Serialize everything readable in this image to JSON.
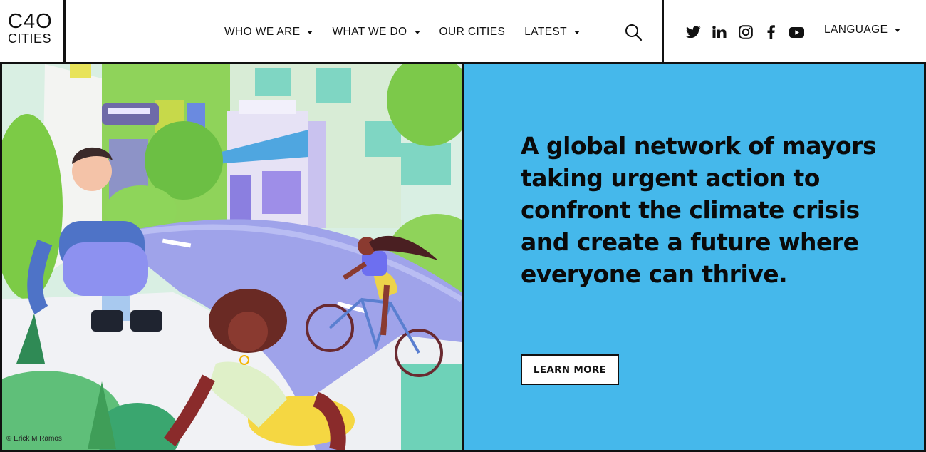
{
  "logo": {
    "line1": "C4O",
    "line2": "CITIES"
  },
  "nav": {
    "items": [
      {
        "label": "WHO WE ARE",
        "has_dropdown": true
      },
      {
        "label": "WHAT WE DO",
        "has_dropdown": true
      },
      {
        "label": "OUR CITIES",
        "has_dropdown": false
      },
      {
        "label": "LATEST",
        "has_dropdown": true
      }
    ],
    "search_icon": "search-icon"
  },
  "social": {
    "icons": [
      "twitter-icon",
      "linkedin-icon",
      "instagram-icon",
      "facebook-icon",
      "youtube-icon"
    ],
    "language_label": "LANGUAGE"
  },
  "hero": {
    "headline": "A global network of mayors taking urgent action to confront the climate crisis and create a future where everyone can thrive.",
    "cta_label": "LEARN MORE",
    "image_credit": "© Erick M Ramos",
    "panel_color": "#45b8eb"
  }
}
